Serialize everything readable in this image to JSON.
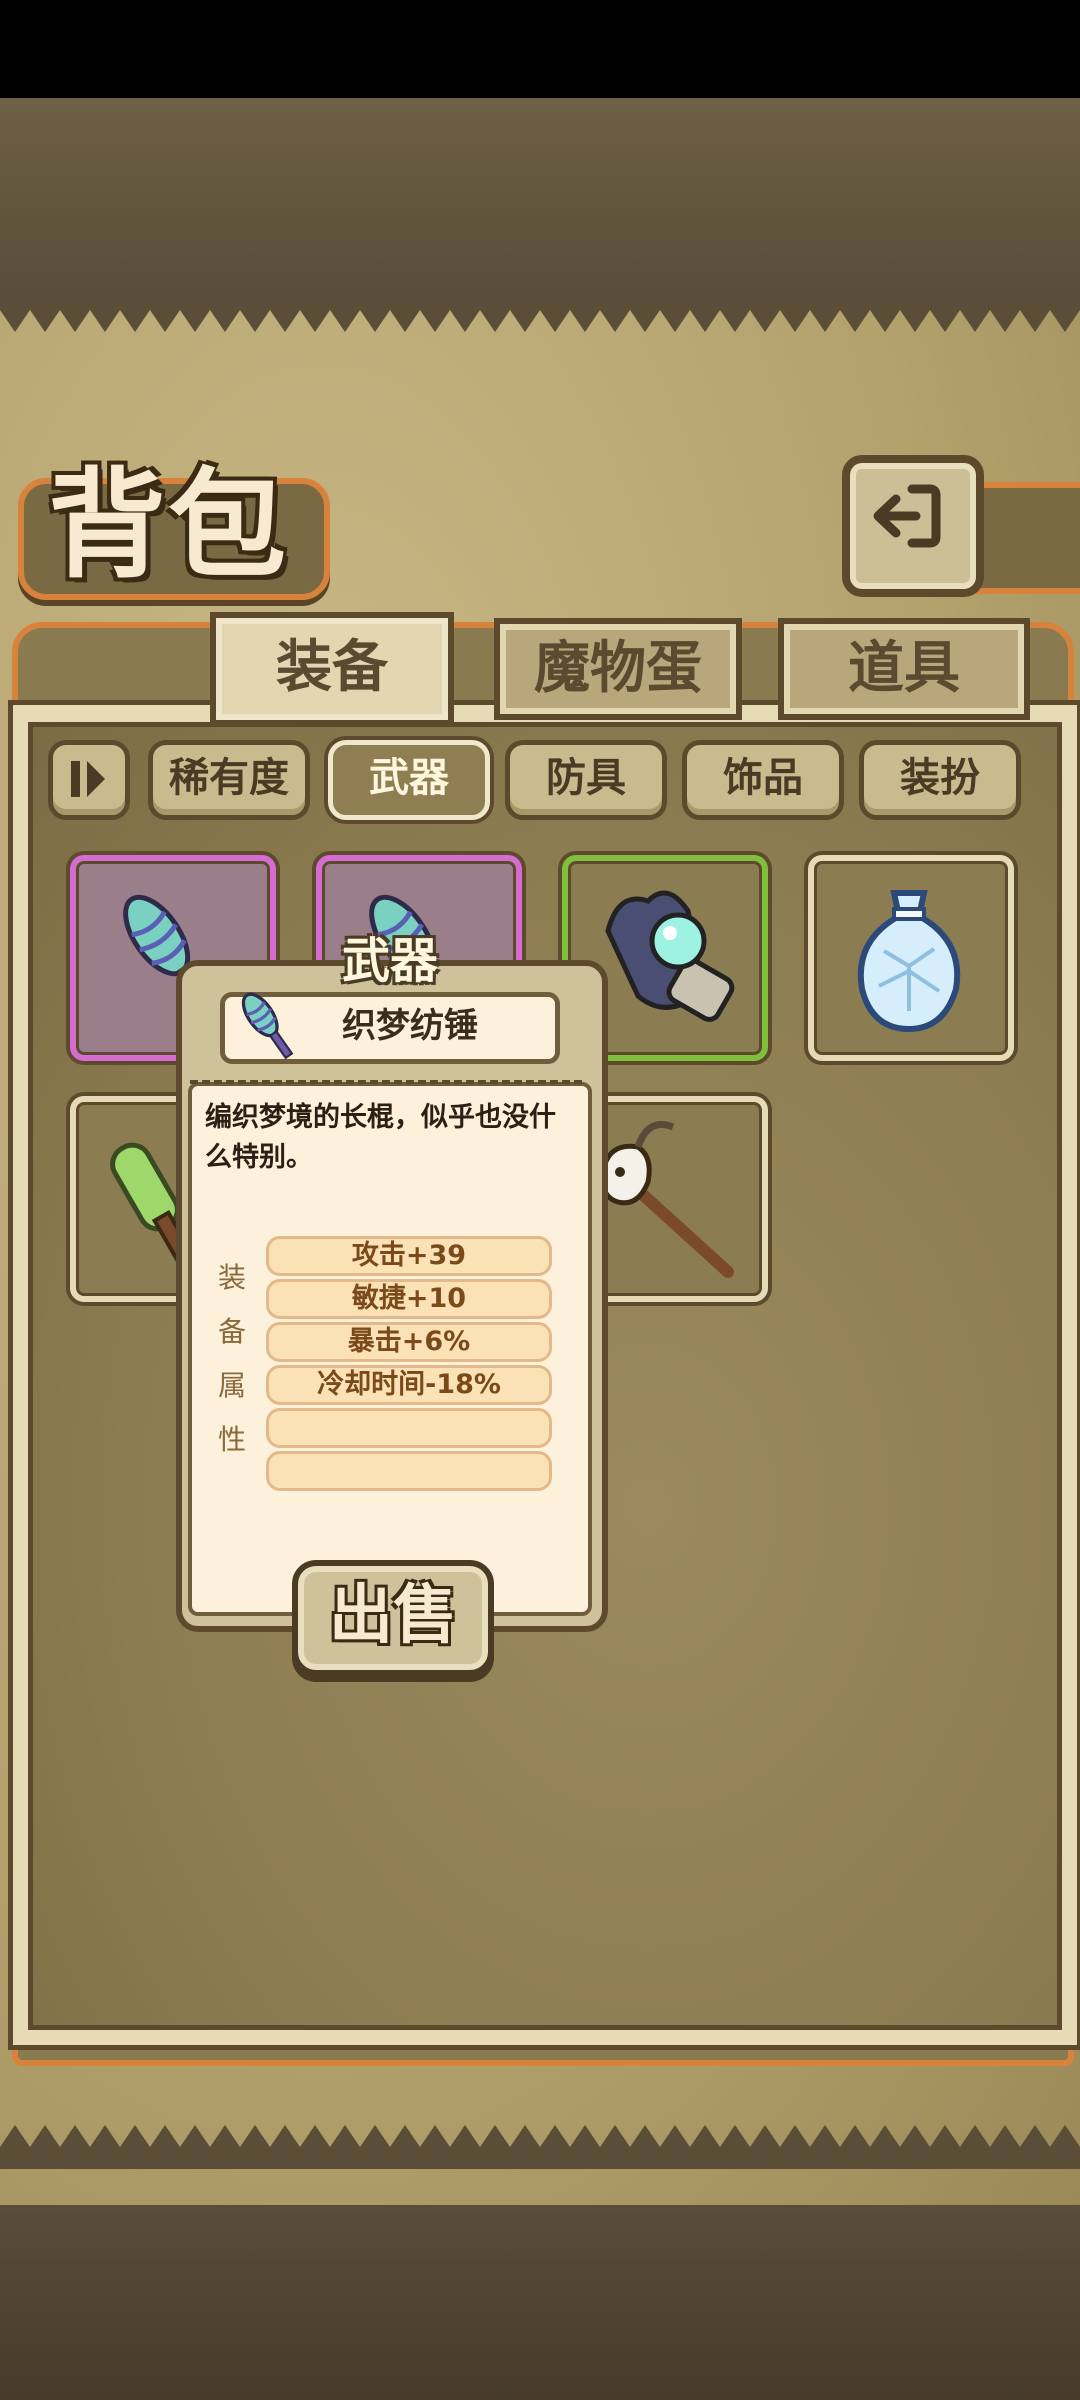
{
  "header": {
    "title": "背包"
  },
  "tabs": [
    {
      "label": "装备",
      "active": true
    },
    {
      "label": "魔物蛋",
      "active": false
    },
    {
      "label": "道具",
      "active": false
    }
  ],
  "filters": {
    "toggle_icon": "sort-toggle-icon",
    "items": [
      {
        "label": "稀有度",
        "selected": false
      },
      {
        "label": "武器",
        "selected": true
      },
      {
        "label": "防具",
        "selected": false
      },
      {
        "label": "饰品",
        "selected": false
      },
      {
        "label": "装扮",
        "selected": false
      }
    ]
  },
  "inventory": {
    "items": [
      {
        "icon": "dream-weaver-spindle-icon",
        "rarity_color": "#d66bd2"
      },
      {
        "icon": "dream-weaver-spindle-icon",
        "rarity_color": "#d66bd2"
      },
      {
        "icon": "orb-gauntlet-icon",
        "rarity_color": "#7fbf3c"
      },
      {
        "icon": "crystal-bag-icon",
        "rarity_color": "#e7dbb6"
      },
      {
        "icon": "green-club-icon",
        "rarity_color": "#e7dbb6"
      },
      {
        "icon": "skull-staff-icon",
        "rarity_color": "#e7dbb6"
      }
    ]
  },
  "popup": {
    "category": "武器",
    "name": "织梦纺锤",
    "description": "编织梦境的长棍，似乎也没什么特别。",
    "attributes_label": [
      "装",
      "备",
      "属",
      "性"
    ],
    "stats": [
      "攻击+39",
      "敏捷+10",
      "暴击+6%",
      "冷却时间-18%",
      "",
      ""
    ],
    "sell_label": "出售"
  },
  "colors": {
    "accent_orange": "#d8833b",
    "rarity_purple": "#d66bd2",
    "rarity_green": "#7fbf3c",
    "panel_brown": "#8c7c51"
  }
}
